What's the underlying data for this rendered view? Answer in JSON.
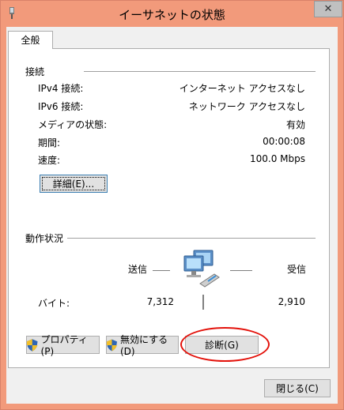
{
  "window": {
    "title": "イーサネットの状態",
    "close_label": "✕"
  },
  "tabs": [
    {
      "label": "全般"
    }
  ],
  "connection": {
    "group_label": "接続",
    "rows": [
      {
        "label": "IPv4 接続:",
        "value": "インターネット アクセスなし"
      },
      {
        "label": "IPv6 接続:",
        "value": "ネットワーク アクセスなし"
      },
      {
        "label": "メディアの状態:",
        "value": "有効"
      },
      {
        "label": "期間:",
        "value": "00:00:08"
      },
      {
        "label": "速度:",
        "value": "100.0 Mbps"
      }
    ],
    "details_button": "詳細(E)..."
  },
  "activity": {
    "group_label": "動作状況",
    "sent_label": "送信",
    "received_label": "受信",
    "bytes_label": "バイト:",
    "bytes_sent": "7,312",
    "bytes_received": "2,910",
    "network_icon": "network-computers-icon"
  },
  "buttons": {
    "properties": "プロパティ(P)",
    "disable": "無効にする(D)",
    "diagnose": "診断(G)",
    "close": "閉じる(C)"
  },
  "colors": {
    "titlebar": "#f29a7b",
    "highlight_ellipse": "#e3120b"
  }
}
